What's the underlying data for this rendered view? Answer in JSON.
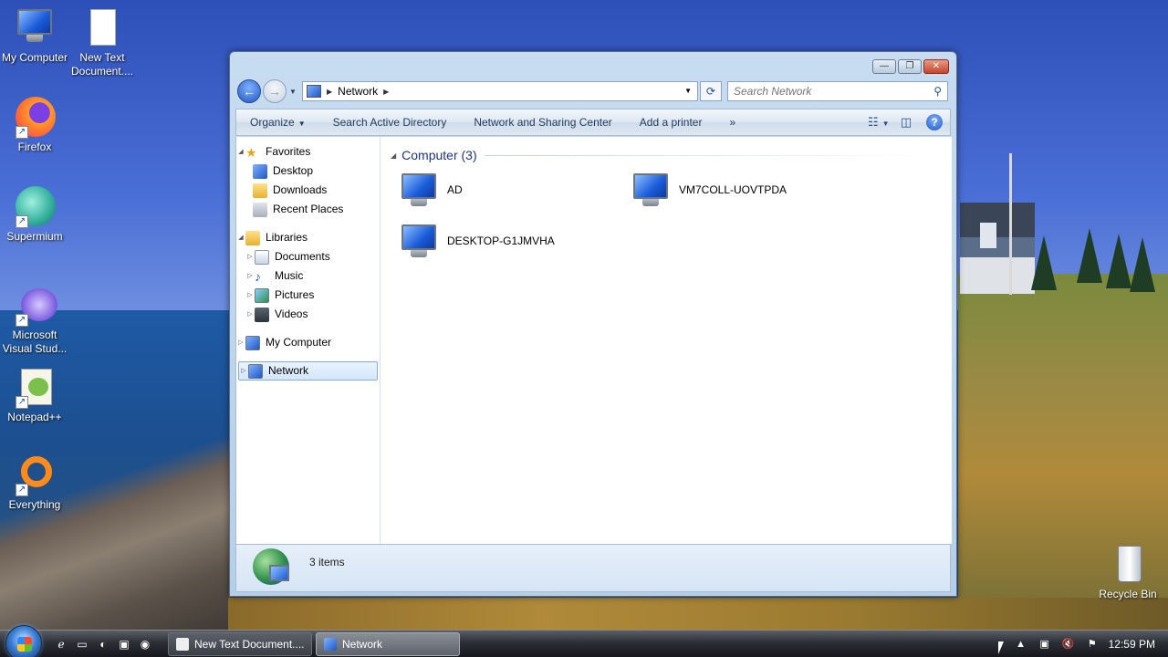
{
  "desktop": {
    "icons": [
      {
        "label": "My Computer"
      },
      {
        "label": "New Text Document...."
      },
      {
        "label": "Firefox"
      },
      {
        "label": "Supermium"
      },
      {
        "label": "Microsoft Visual Stud..."
      },
      {
        "label": "Notepad++"
      },
      {
        "label": "Everything"
      },
      {
        "label": "Recycle Bin"
      }
    ]
  },
  "window": {
    "caption_buttons": {
      "minimize": "—",
      "maximize": "❐",
      "close": "✕"
    },
    "address": {
      "path_item": "Network"
    },
    "search": {
      "placeholder": "Search Network"
    },
    "toolbar": {
      "organize": "Organize",
      "search_ad": "Search Active Directory",
      "network_sharing": "Network and Sharing Center",
      "add_printer": "Add a printer",
      "more": "»"
    },
    "nav_pane": {
      "favorites": "Favorites",
      "desktop": "Desktop",
      "downloads": "Downloads",
      "recent_places": "Recent Places",
      "libraries": "Libraries",
      "documents": "Documents",
      "music": "Music",
      "pictures": "Pictures",
      "videos": "Videos",
      "my_computer": "My Computer",
      "network": "Network"
    },
    "main": {
      "group_header": "Computer (3)",
      "computers": [
        "AD",
        "VM7COLL-UOVTPDA",
        "DESKTOP-G1JMVHA"
      ]
    },
    "details": {
      "count": "3 items"
    }
  },
  "taskbar": {
    "buttons": [
      "New Text Document....",
      "Network"
    ],
    "clock": "12:59 PM"
  },
  "colors": {
    "accent": "#1f57c4",
    "group_header": "#1e3287",
    "selection_border": "#84acdd"
  }
}
